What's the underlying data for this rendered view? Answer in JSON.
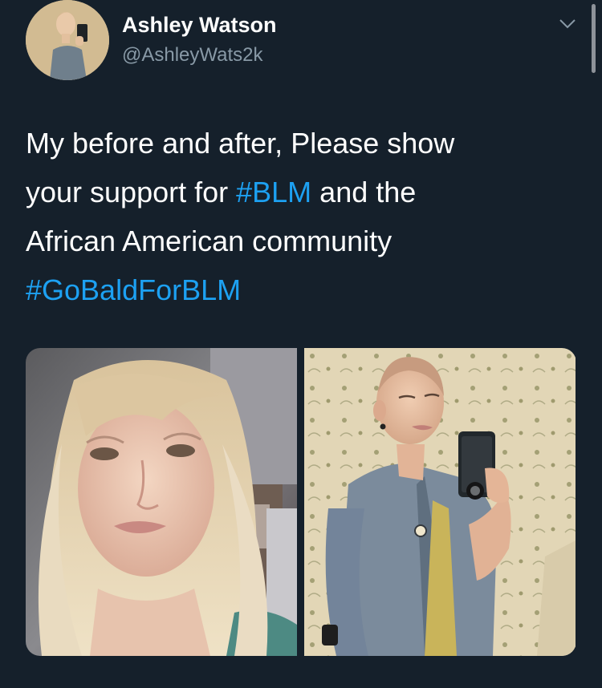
{
  "author": {
    "name": "Ashley Watson",
    "handle": "@AshleyWats2k",
    "avatar_icon": "profile-photo"
  },
  "menu": {
    "icon": "chevron-down-icon"
  },
  "tweet": {
    "lines": [
      [
        {
          "text": "My before and after, Please show",
          "type": "text"
        }
      ],
      [
        {
          "text": "your support for ",
          "type": "text"
        },
        {
          "text": "#BLM",
          "type": "hashtag"
        },
        {
          "text": " and the",
          "type": "text"
        }
      ],
      [
        {
          "text": "African American community",
          "type": "text"
        }
      ],
      [
        {
          "text": "#GoBaldForBLM",
          "type": "hashtag"
        }
      ]
    ]
  },
  "media": {
    "photos": [
      {
        "name": "before-photo"
      },
      {
        "name": "after-photo"
      }
    ]
  },
  "colors": {
    "background": "#15202b",
    "text": "#ffffff",
    "secondary_text": "#8899a6",
    "hashtag": "#1da1f2"
  }
}
